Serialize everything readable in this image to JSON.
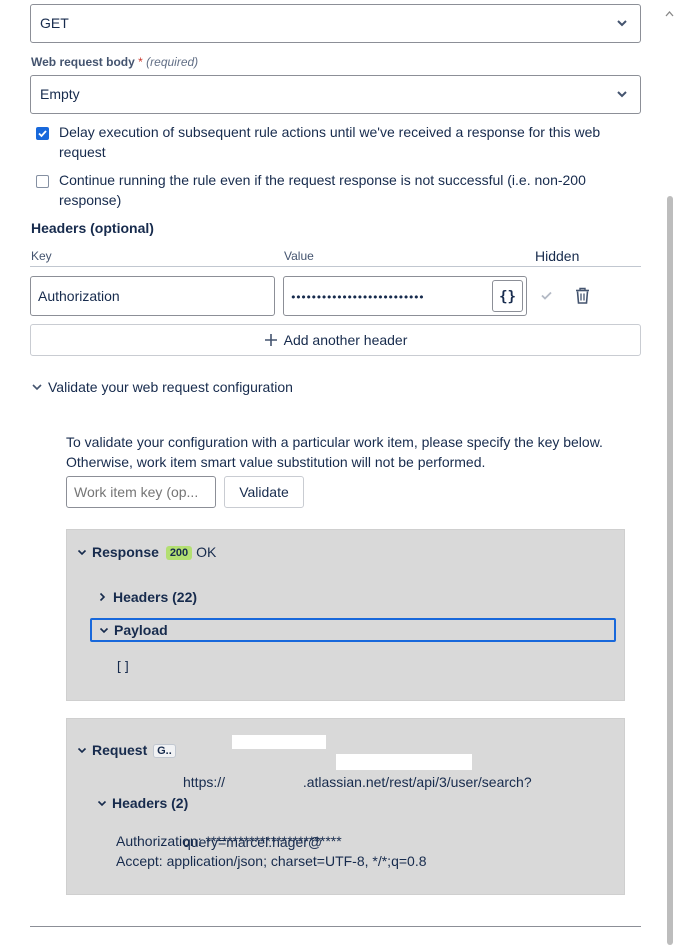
{
  "method_select": {
    "value": "GET"
  },
  "body_field": {
    "label": "Web request body",
    "required_star": "*",
    "required_note": "(required)",
    "value": "Empty"
  },
  "options": {
    "delay_text": "Delay execution of subsequent rule actions until we've received a response for this web request",
    "delay_checked": true,
    "continue_text": "Continue running the rule even if the request response is not successful (i.e. non-200 response)",
    "continue_checked": false
  },
  "headers_section": {
    "title": "Headers (optional)",
    "col_key": "Key",
    "col_value": "Value",
    "col_hidden": "Hidden",
    "row": {
      "key": "Authorization",
      "value": "••••••••••••••••••••••••••",
      "smart_value_icon": "{}"
    },
    "add_label": "Add another header"
  },
  "validate": {
    "toggle_label": "Validate your web request configuration",
    "description": "To validate your configuration with a particular work item, please specify the key below. Otherwise, work item smart value substitution will not be performed.",
    "input_placeholder": "Work item key (op...",
    "button_label": "Validate"
  },
  "response": {
    "label": "Response",
    "status_code": "200",
    "status_text": "OK",
    "headers_label": "Headers (22)",
    "payload_label": "Payload",
    "payload_value": "[]"
  },
  "request": {
    "label": "Request",
    "method_badge": "G..",
    "url_line1": "https://                    .atlassian.net/rest/api/3/user/search?",
    "url_line2": "query=marcel.hager@",
    "headers_label": "Headers (2)",
    "header_lines": [
      "Authorization: *************************",
      "Accept: application/json; charset=UTF-8, */*;q=0.8"
    ]
  },
  "colors": {
    "accent": "#1868db",
    "status_badge": "#b3df72",
    "panel_bg": "#d9d9d9",
    "focus_outline": "#1868db"
  },
  "icons": [
    "chevron-down-icon",
    "checkbox-checked-icon",
    "checkbox-empty-icon",
    "check-icon",
    "trash-icon",
    "plus-icon",
    "chevron-right-icon"
  ]
}
